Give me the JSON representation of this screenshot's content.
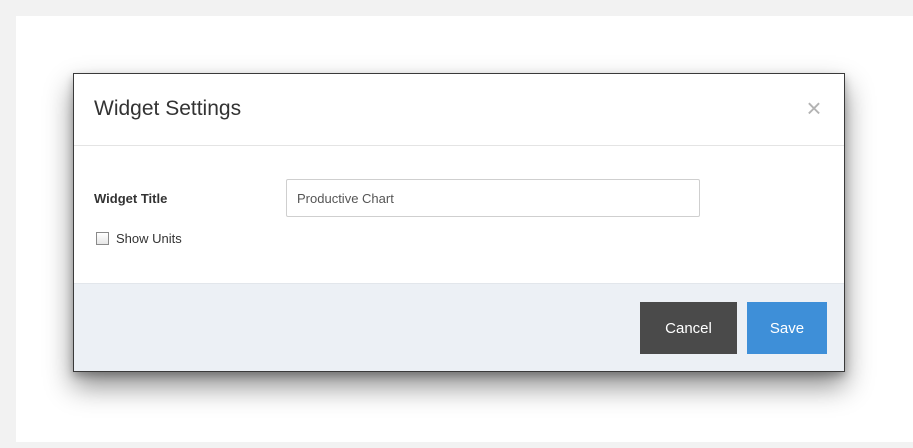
{
  "modal": {
    "title": "Widget Settings",
    "close_symbol": "×",
    "close_icon": "close-icon",
    "field_label": "Widget Title",
    "input_value": "Productive Chart",
    "checkbox_label": "Show Units",
    "checkbox_checked": false,
    "cancel_label": "Cancel",
    "save_label": "Save"
  },
  "colors": {
    "cancel_button": "#4a4a4a",
    "save_button": "#3e8fd8",
    "footer_background": "#ecf0f5",
    "page_background": "#f2f2f2"
  }
}
